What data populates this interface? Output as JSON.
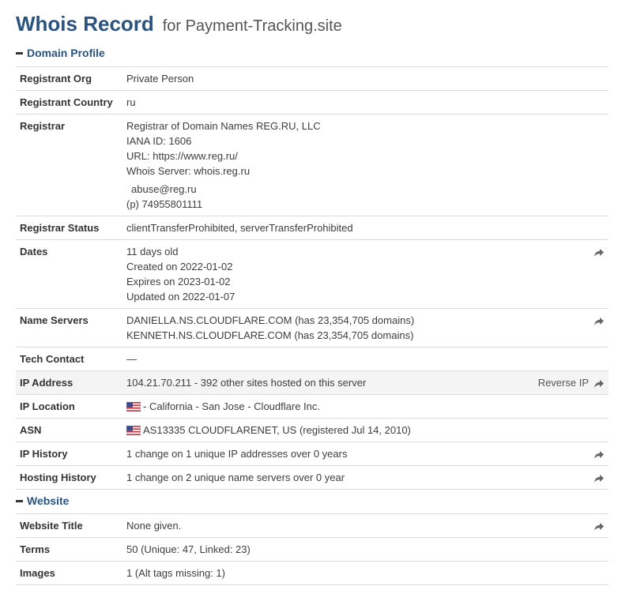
{
  "header": {
    "title": "Whois Record",
    "subtitle": "for Payment-Tracking.site"
  },
  "domain_profile": {
    "heading": "Domain Profile",
    "registrant_org": {
      "label": "Registrant Org",
      "value": "Private Person"
    },
    "registrant_country": {
      "label": "Registrant Country",
      "value": "ru"
    },
    "registrar": {
      "label": "Registrar",
      "name": "Registrar of Domain Names REG.RU, LLC",
      "iana": "IANA ID: 1606",
      "url": "URL: https://www.reg.ru/",
      "whois_server": "Whois Server: whois.reg.ru",
      "email": "abuse@reg.ru",
      "phone_prefix": "(p)",
      "phone": "74955801111"
    },
    "registrar_status": {
      "label": "Registrar Status",
      "value": "clientTransferProhibited, serverTransferProhibited"
    },
    "dates": {
      "label": "Dates",
      "age": "11 days old",
      "created": "Created on 2022-01-02",
      "expires": "Expires on 2023-01-02",
      "updated": "Updated on 2022-01-07"
    },
    "name_servers": {
      "label": "Name Servers",
      "servers": [
        "DANIELLA.NS.CLOUDFLARE.COM (has 23,354,705 domains)",
        "KENNETH.NS.CLOUDFLARE.COM (has 23,354,705 domains)"
      ]
    },
    "tech_contact": {
      "label": "Tech Contact",
      "value": "—"
    },
    "ip_address": {
      "label": "IP Address",
      "value": "104.21.70.211 - 392 other sites hosted on this server",
      "action": "Reverse IP"
    },
    "ip_location": {
      "label": "IP Location",
      "value": "- California - San Jose - Cloudflare Inc.",
      "flag_icon": "us-flag-icon"
    },
    "asn": {
      "label": "ASN",
      "value": "AS13335 CLOUDFLARENET, US (registered Jul 14, 2010)",
      "flag_icon": "us-flag-icon"
    },
    "ip_history": {
      "label": "IP History",
      "value": "1 change on 1 unique IP addresses over 0 years"
    },
    "hosting_history": {
      "label": "Hosting History",
      "value": "1 change on 2 unique name servers over 0 year"
    }
  },
  "website": {
    "heading": "Website",
    "title": {
      "label": "Website Title",
      "value": "None given."
    },
    "terms": {
      "label": "Terms",
      "value": "50 (Unique: 47, Linked: 23)"
    },
    "images": {
      "label": "Images",
      "value": "1 (Alt tags missing: 1)"
    }
  },
  "colors": {
    "title_blue": "#2b5380",
    "row_highlight": "#f4f4f4",
    "border": "#dddddd",
    "share_icon": "#666666"
  },
  "icons": {
    "share": "share-arrow-icon",
    "collapse": "minus-icon",
    "flag": "us-flag-icon"
  }
}
